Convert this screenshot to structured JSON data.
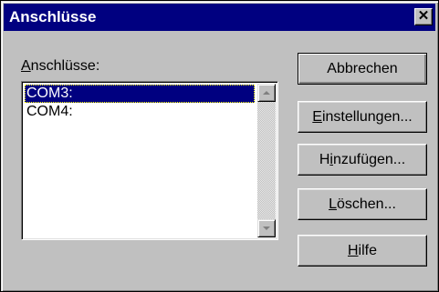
{
  "window": {
    "title": "Anschlüsse",
    "close_glyph": "✕"
  },
  "list": {
    "label_accel": "A",
    "label_rest": "nschlüsse:",
    "items": [
      {
        "label": "COM3:",
        "selected": true
      },
      {
        "label": "COM4:",
        "selected": false
      }
    ]
  },
  "buttons": {
    "cancel": {
      "label": "Abbrechen"
    },
    "settings": {
      "accel": "E",
      "rest": "instellungen..."
    },
    "add": {
      "pre": "H",
      "accel": "i",
      "rest": "nzufügen..."
    },
    "delete": {
      "accel": "L",
      "rest": "öschen..."
    },
    "help": {
      "accel": "H",
      "rest": "ilfe"
    }
  },
  "colors": {
    "face": "#c0c0c0",
    "titlebar": "#000080",
    "selection": "#000080"
  }
}
